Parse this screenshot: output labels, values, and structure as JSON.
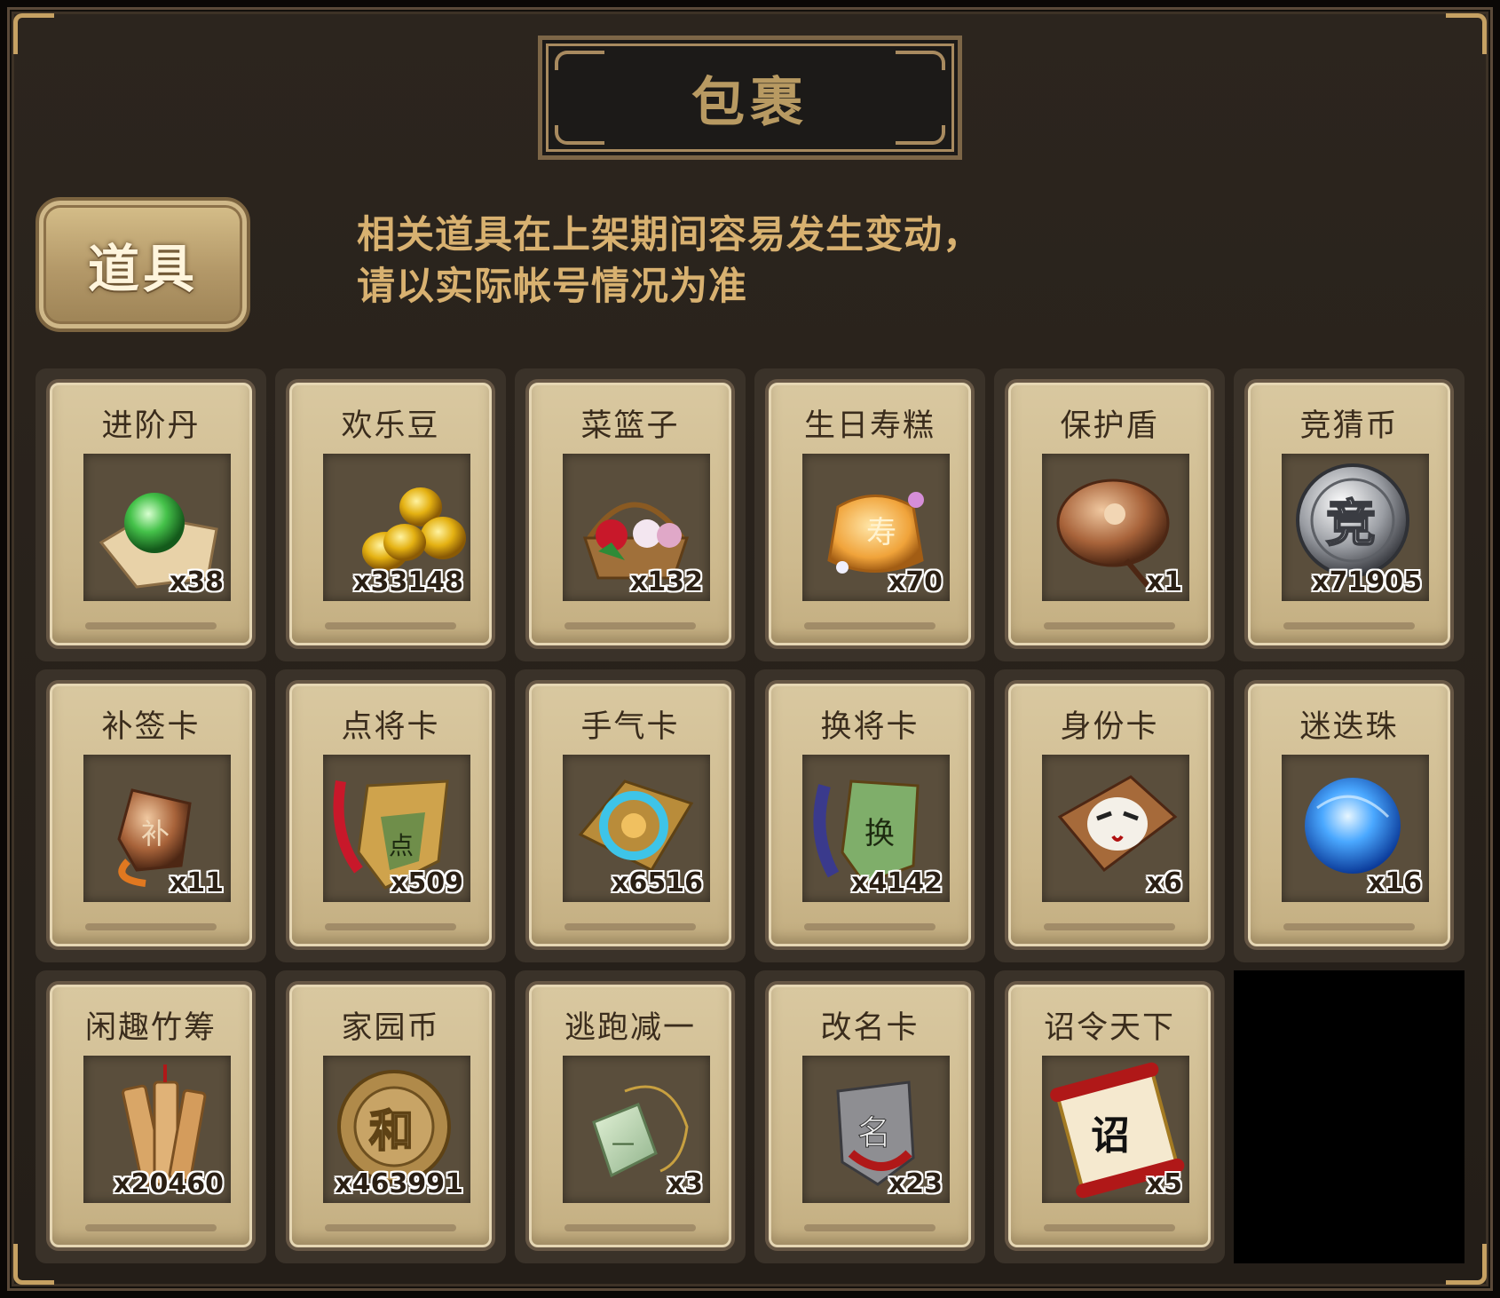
{
  "window": {
    "title": "包裹",
    "tab": "道具",
    "notice_line1": "相关道具在上架期间容易发生变动，",
    "notice_line2": "请以实际帐号情况为准"
  },
  "items": [
    {
      "name": "进阶丹",
      "count": "x38",
      "icon": "green-orb-icon"
    },
    {
      "name": "欢乐豆",
      "count": "x33148",
      "icon": "gold-beans-icon"
    },
    {
      "name": "菜篮子",
      "count": "x132",
      "icon": "flower-basket-icon"
    },
    {
      "name": "生日寿糕",
      "count": "x70",
      "icon": "birthday-cake-icon"
    },
    {
      "name": "保护盾",
      "count": "x1",
      "icon": "round-shield-icon"
    },
    {
      "name": "竞猜币",
      "count": "x71905",
      "icon": "silver-coin-icon"
    },
    {
      "name": "补签卡",
      "count": "x11",
      "icon": "bronze-tag-icon"
    },
    {
      "name": "点将卡",
      "count": "x509",
      "icon": "general-card-icon"
    },
    {
      "name": "手气卡",
      "count": "x6516",
      "icon": "luck-card-icon"
    },
    {
      "name": "换将卡",
      "count": "x4142",
      "icon": "swap-card-icon"
    },
    {
      "name": "身份卡",
      "count": "x6",
      "icon": "opera-mask-card-icon"
    },
    {
      "name": "迷迭珠",
      "count": "x16",
      "icon": "blue-orb-icon"
    },
    {
      "name": "闲趣竹筹",
      "count": "x20460",
      "icon": "bamboo-tokens-icon"
    },
    {
      "name": "家园币",
      "count": "x463991",
      "icon": "gold-coin-icon"
    },
    {
      "name": "逃跑减一",
      "count": "x3",
      "icon": "jade-pendant-icon"
    },
    {
      "name": "改名卡",
      "count": "x23",
      "icon": "rename-plaque-icon"
    },
    {
      "name": "诏令天下",
      "count": "x5",
      "icon": "imperial-scroll-icon"
    }
  ],
  "colors": {
    "frame": "#2c251e",
    "gold_text": "#d8b170",
    "card_bg": "#cdb98d"
  }
}
